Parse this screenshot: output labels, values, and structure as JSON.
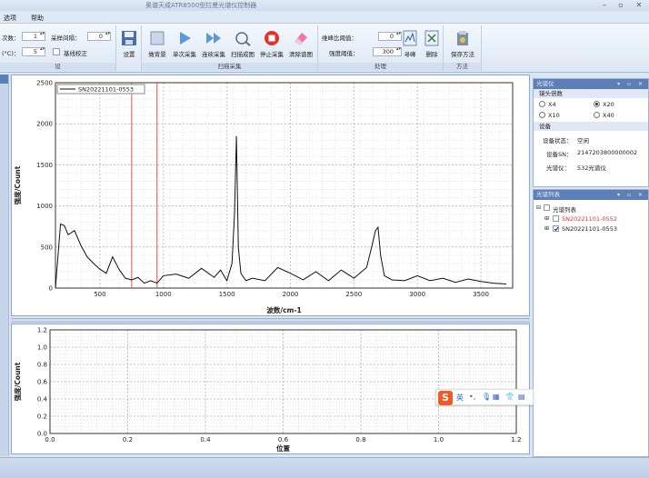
{
  "window": {
    "title": "奥谱天成ATR8500型拉曼光谱仪控制器"
  },
  "menu": {
    "items": [
      "选项",
      "帮助"
    ]
  },
  "ribbon": {
    "fields": {
      "count_label": "次数：",
      "count_value": "1",
      "sample_interval_label": "采样间隔：",
      "sample_interval_value": "0",
      "temp_label": "(°C)：",
      "temp_value": "5",
      "baseline_label": "基线校正",
      "smooth_label": "维峰比阈值：",
      "smooth_value": "0",
      "fit_label": "强度阈值：",
      "fit_value": "300"
    },
    "buttons": {
      "settings": "设置",
      "background": "做背景",
      "single_scan": "单次采集",
      "continuous_scan": "连续采集",
      "scan_stream": "扫描成图",
      "stop_scan": "停止采集",
      "clear_graph": "清除谱图",
      "find_peak": "寻峰",
      "delete": "删除",
      "save_method": "保存方法"
    },
    "group_labels": {
      "params": "设",
      "scan": "扫描采集",
      "process": "处理",
      "method": "方法"
    }
  },
  "right_panel": {
    "caption": "光谱仪",
    "lens_section": "镜头倍数",
    "lens_options": [
      "X4",
      "X20",
      "X10",
      "X40"
    ],
    "lens_selected": "X20",
    "device_section": "设备",
    "device_status_label": "设备状态：",
    "device_status_value": "空闲",
    "device_sn_label": "设备SN：",
    "device_sn_value": "2147203800000002",
    "spectrometer_label": "光谱仪：",
    "spectrometer_value": "532光谱仪",
    "list_caption": "光谱列表",
    "tree_root": "光谱列表",
    "tree_items": [
      {
        "label": "SN20221101-0552",
        "color": "#d9342b",
        "checked": false
      },
      {
        "label": "SN20221101-0553",
        "color": "#222222",
        "checked": true
      }
    ]
  },
  "ime": {
    "logo": "S",
    "lang": "英"
  },
  "chart_data": [
    {
      "type": "line",
      "xlabel": "波数/cm-1",
      "ylabel": "强度/Count",
      "xlim": [
        150,
        3750
      ],
      "ylim": [
        0,
        2500
      ],
      "xticks": [
        500,
        1000,
        1500,
        2000,
        2500,
        3000,
        3500
      ],
      "yticks": [
        0,
        500,
        1000,
        1500,
        2000,
        2500
      ],
      "grid": true,
      "legend": "top-left",
      "markers_x": [
        750,
        950
      ],
      "series": [
        {
          "name": "SN20221101-0553",
          "x": [
            150,
            190,
            220,
            250,
            300,
            350,
            400,
            450,
            500,
            550,
            600,
            650,
            700,
            750,
            800,
            850,
            900,
            950,
            1000,
            1100,
            1200,
            1300,
            1400,
            1450,
            1500,
            1540,
            1560,
            1575,
            1590,
            1610,
            1650,
            1700,
            1800,
            1900,
            2000,
            2100,
            2200,
            2300,
            2400,
            2500,
            2600,
            2640,
            2670,
            2690,
            2710,
            2740,
            2800,
            2900,
            3000,
            3100,
            3200,
            3300,
            3400,
            3500,
            3600,
            3700
          ],
          "y": [
            0,
            780,
            760,
            650,
            700,
            520,
            380,
            300,
            230,
            180,
            380,
            230,
            120,
            100,
            130,
            60,
            90,
            60,
            150,
            170,
            120,
            240,
            130,
            220,
            90,
            300,
            900,
            1850,
            500,
            180,
            90,
            120,
            90,
            250,
            180,
            100,
            200,
            90,
            220,
            120,
            250,
            500,
            700,
            740,
            400,
            150,
            100,
            90,
            150,
            90,
            120,
            70,
            110,
            80,
            60,
            50
          ]
        }
      ]
    },
    {
      "type": "line",
      "xlabel": "位置",
      "ylabel": "强度/Count",
      "xlim": [
        0,
        1.2
      ],
      "ylim": [
        0,
        1.2
      ],
      "xticks": [
        0.0,
        0.2,
        0.4,
        0.6,
        0.8,
        1.0,
        1.2
      ],
      "yticks": [
        0.0,
        0.2,
        0.4,
        0.6,
        0.8,
        1.0,
        1.2
      ],
      "grid": true,
      "series": []
    }
  ]
}
